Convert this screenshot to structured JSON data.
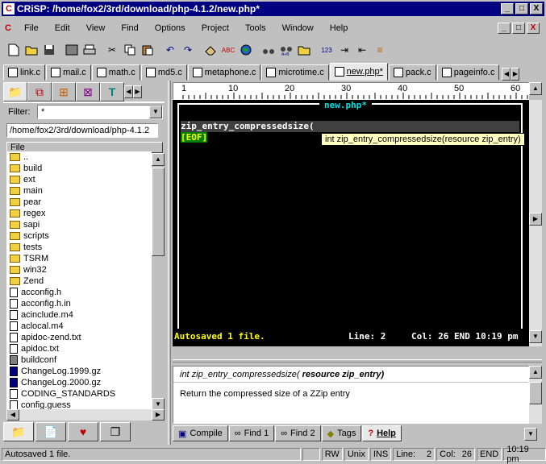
{
  "window": {
    "title": "CRiSP: /home/fox2/3rd/download/php-4.1.2/new.php*",
    "app_icon": "C",
    "controls": [
      "_",
      "□",
      "X"
    ]
  },
  "menu": [
    "File",
    "Edit",
    "View",
    "Find",
    "Options",
    "Project",
    "Tools",
    "Window",
    "Help"
  ],
  "toolbar_icons": [
    "new-file-icon",
    "open-folder-icon",
    "save-icon",
    "save-all-icon",
    "print-icon",
    "cut-icon",
    "copy-icon",
    "paste-icon",
    "undo-icon",
    "redo-icon",
    "eraser-icon",
    "spellcheck-icon",
    "globe-icon",
    "find-icon",
    "replace-icon",
    "find-in-files-icon",
    "numbering-icon",
    "indent-icon",
    "outdent-icon",
    "wrap-icon"
  ],
  "file_tabs": [
    {
      "label": "link.c"
    },
    {
      "label": "mail.c"
    },
    {
      "label": "math.c"
    },
    {
      "label": "md5.c"
    },
    {
      "label": "metaphone.c"
    },
    {
      "label": "microtime.c"
    },
    {
      "label": "new.php*",
      "active": true
    },
    {
      "label": "pack.c"
    },
    {
      "label": "pageinfo.c"
    }
  ],
  "left_panel": {
    "filter_label": "Filter:",
    "filter_value": "*",
    "path": "/home/fox2/3rd/download/php-4.1.2",
    "header": "File",
    "items": [
      {
        "name": "..",
        "type": "folder"
      },
      {
        "name": "build",
        "type": "folder"
      },
      {
        "name": "ext",
        "type": "folder"
      },
      {
        "name": "main",
        "type": "folder"
      },
      {
        "name": "pear",
        "type": "folder"
      },
      {
        "name": "regex",
        "type": "folder"
      },
      {
        "name": "sapi",
        "type": "folder"
      },
      {
        "name": "scripts",
        "type": "folder"
      },
      {
        "name": "tests",
        "type": "folder"
      },
      {
        "name": "TSRM",
        "type": "folder"
      },
      {
        "name": "win32",
        "type": "folder"
      },
      {
        "name": "Zend",
        "type": "folder"
      },
      {
        "name": "acconfig.h",
        "type": "file"
      },
      {
        "name": "acconfig.h.in",
        "type": "file"
      },
      {
        "name": "acinclude.m4",
        "type": "file"
      },
      {
        "name": "aclocal.m4",
        "type": "file"
      },
      {
        "name": "apidoc-zend.txt",
        "type": "file"
      },
      {
        "name": "apidoc.txt",
        "type": "file"
      },
      {
        "name": "buildconf",
        "type": "exec"
      },
      {
        "name": "ChangeLog.1999.gz",
        "type": "gz"
      },
      {
        "name": "ChangeLog.2000.gz",
        "type": "gz"
      },
      {
        "name": "CODING_STANDARDS",
        "type": "file"
      },
      {
        "name": "config.guess",
        "type": "file"
      }
    ]
  },
  "ruler": {
    "marks": [
      "1",
      "10",
      "20",
      "30",
      "40",
      "50",
      "60"
    ]
  },
  "editor": {
    "title": "new.php*",
    "line1": "zip_entry_compressedsize(",
    "eof": "[EOF]",
    "tooltip": "int zip_entry_compressedsize(resource zip_entry)",
    "status_left": "Autosaved 1 file.",
    "status_line": "Line: 2",
    "status_col": "Col: 26 END 10:19 pm"
  },
  "help_panel": {
    "signature_pre": "int zip_entry_compressedsize( ",
    "signature_bold": "resource zip_entry)",
    "description": "Return the compressed size of a ZZip entry"
  },
  "bottom_tabs": [
    {
      "label": "Compile"
    },
    {
      "label": "Find 1"
    },
    {
      "label": "Find 2"
    },
    {
      "label": "Tags"
    },
    {
      "label": "Help",
      "active": true
    }
  ],
  "status": {
    "message": "Autosaved 1 file.",
    "rw": "RW",
    "unix": "Unix",
    "ins": "INS",
    "line_label": "Line:",
    "line": "2",
    "col_label": "Col:",
    "col": "26",
    "end": "END",
    "time": "10:19 pm"
  }
}
